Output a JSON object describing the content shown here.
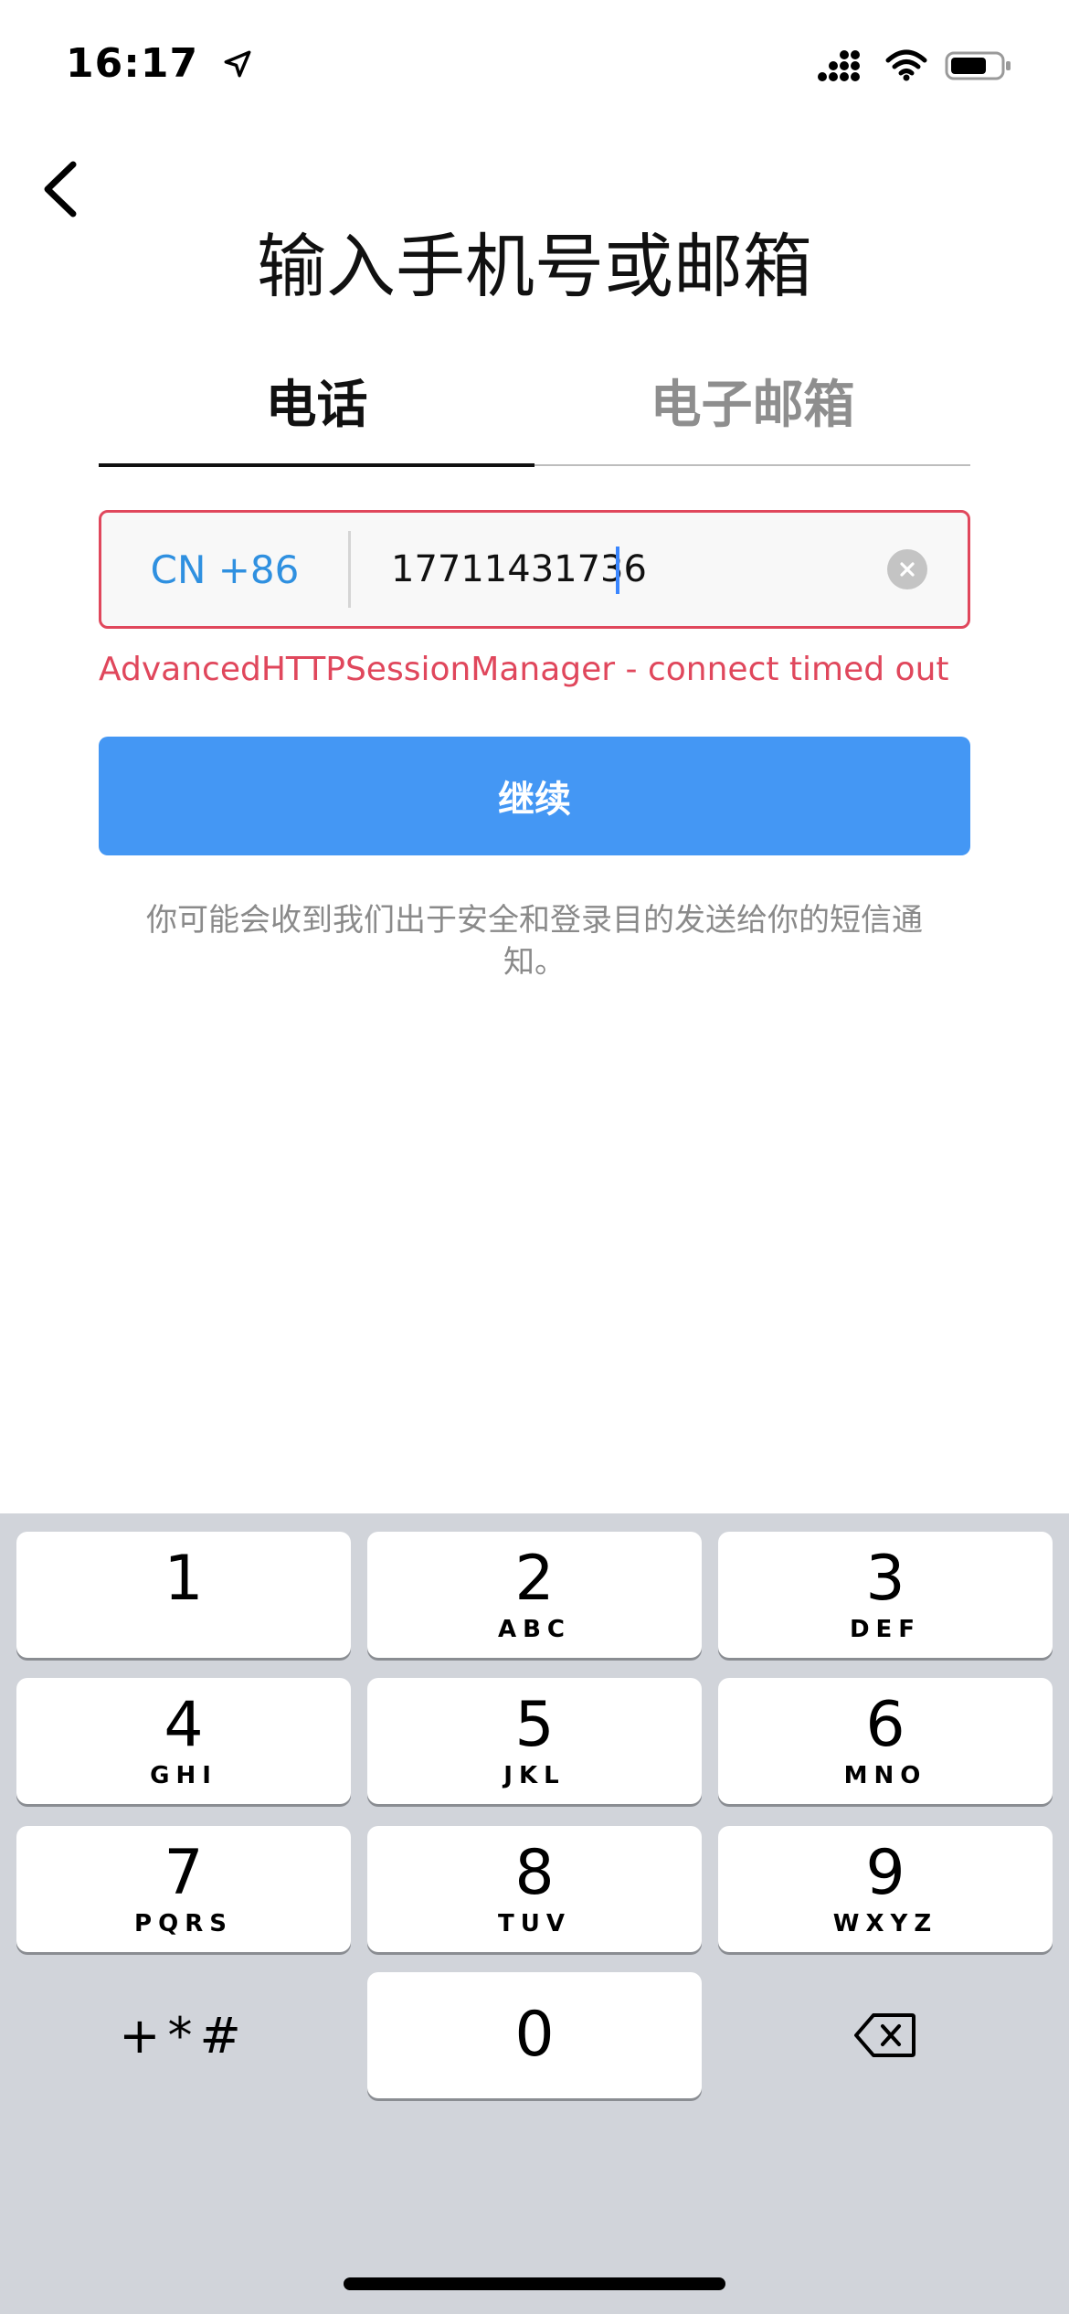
{
  "status": {
    "time": "16:17"
  },
  "header": {
    "title": "输入手机号或邮箱"
  },
  "tabs": [
    {
      "label": "电话",
      "active": true
    },
    {
      "label": "电子邮箱",
      "active": false
    }
  ],
  "phone": {
    "country_code": "CN +86",
    "value": "17711431736"
  },
  "error_message": "AdvancedHTTPSessionManager - connect timed out",
  "continue_label": "继续",
  "notice": "你可能会收到我们出于安全和登录目的发送给你的短信通知。",
  "keypad": {
    "k1": {
      "num": "1",
      "letters": ""
    },
    "k2": {
      "num": "2",
      "letters": "ABC"
    },
    "k3": {
      "num": "3",
      "letters": "DEF"
    },
    "k4": {
      "num": "4",
      "letters": "GHI"
    },
    "k5": {
      "num": "5",
      "letters": "JKL"
    },
    "k6": {
      "num": "6",
      "letters": "MNO"
    },
    "k7": {
      "num": "7",
      "letters": "PQRS"
    },
    "k8": {
      "num": "8",
      "letters": "TUV"
    },
    "k9": {
      "num": "9",
      "letters": "WXYZ"
    },
    "k0": {
      "num": "0"
    },
    "symbols": "+*#"
  },
  "colors": {
    "accent": "#4497f4",
    "error": "#e0475c",
    "country_code": "#2f90e0"
  }
}
